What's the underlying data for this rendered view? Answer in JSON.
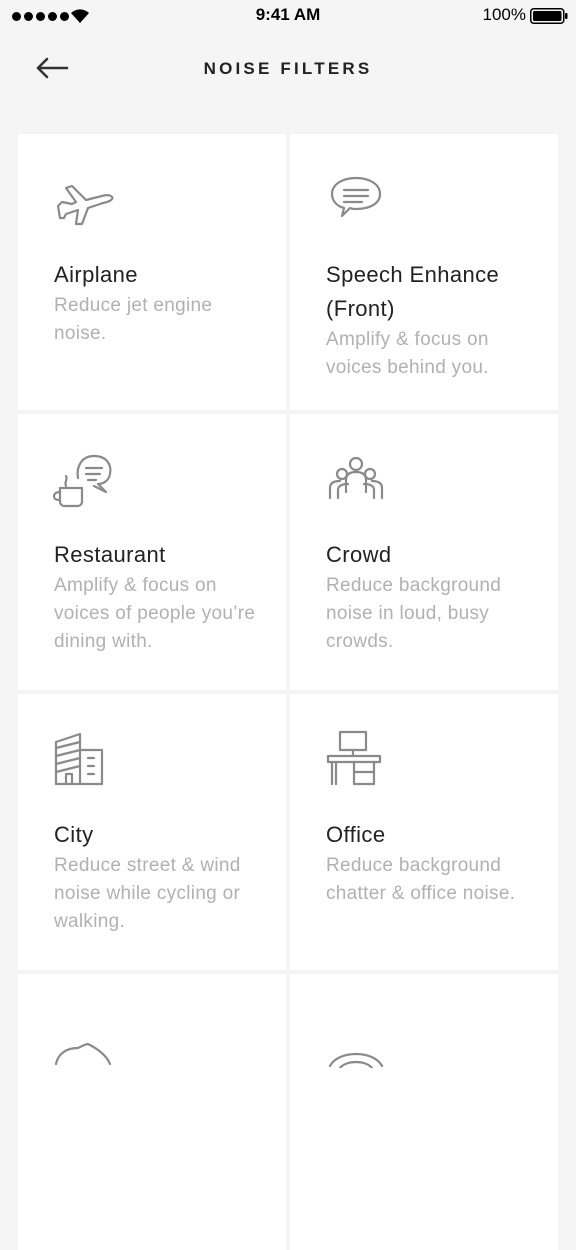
{
  "status_bar": {
    "time": "9:41 AM",
    "battery": "100%"
  },
  "header": {
    "title": "NOISE FILTERS"
  },
  "filters": [
    {
      "title": "Airplane",
      "description": "Reduce jet engine noise.",
      "icon": "airplane-icon"
    },
    {
      "title": "Speech Enhance (Front)",
      "description": "Amplify & focus on voices behind you.",
      "icon": "speech-bubble-icon"
    },
    {
      "title": "Restaurant",
      "description": "Amplify & focus on voices of people you’re dining with.",
      "icon": "restaurant-icon"
    },
    {
      "title": "Crowd",
      "description": "Reduce background noise in loud, busy crowds.",
      "icon": "crowd-icon"
    },
    {
      "title": "City",
      "description": "Reduce street & wind noise while cycling or walking.",
      "icon": "city-icon"
    },
    {
      "title": "Office",
      "description": "Reduce background chatter & office noise.",
      "icon": "office-desk-icon"
    }
  ],
  "colors": {
    "background": "#f5f5f5",
    "card": "#ffffff",
    "title_text": "#222222",
    "description_text": "#b1b1b1",
    "icon_stroke": "#8a8a8a"
  }
}
